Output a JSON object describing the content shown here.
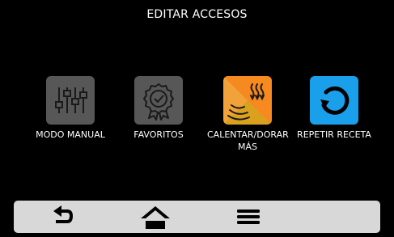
{
  "header": {
    "title": "EDITAR ACCESOS"
  },
  "tiles": [
    {
      "label": "MODO MANUAL",
      "icon": "sliders-icon"
    },
    {
      "label": "FAVORITOS",
      "icon": "award-badge-icon"
    },
    {
      "label": "CALENTAR/DORAR MÁS",
      "icon": "heat-waves-icon"
    },
    {
      "label": "REPETIR RECETA",
      "icon": "repeat-icon"
    }
  ],
  "navbar": {
    "items": [
      {
        "icon": "back-arrow-icon"
      },
      {
        "icon": "home-icon"
      },
      {
        "icon": "menu-icon"
      }
    ]
  },
  "colors": {
    "background": "#000000",
    "tile_gray": "#575757",
    "tile_orange": "#f6891f",
    "tile_yellow": "#d9a11e",
    "tile_blue": "#1aa0ea",
    "navbar": "#d8d8d8"
  }
}
